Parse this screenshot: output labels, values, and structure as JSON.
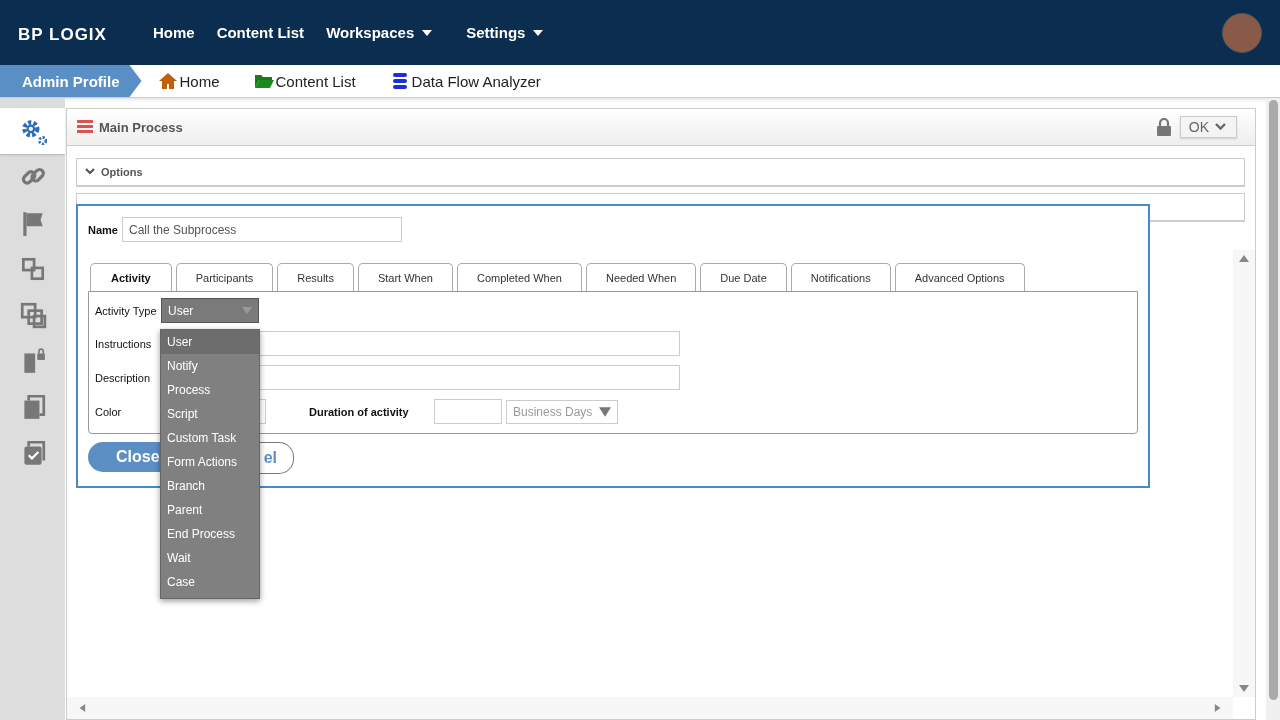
{
  "nav": {
    "logo": "BP LOGIX",
    "items": [
      {
        "label": "Home",
        "kind": "link"
      },
      {
        "label": "Content List",
        "kind": "link"
      },
      {
        "label": "Workspaces",
        "kind": "menu"
      },
      {
        "label": "Settings",
        "kind": "menu"
      }
    ]
  },
  "breadcrumb": {
    "profile": "Admin Profile",
    "links": [
      {
        "label": "Home",
        "kind": "home"
      },
      {
        "label": "Content List",
        "kind": "folder"
      },
      {
        "label": "Data Flow Analyzer",
        "kind": "stack"
      }
    ]
  },
  "sidebar": {
    "items": [
      {
        "kind": "gears",
        "selected": true
      },
      {
        "kind": "link",
        "selected": false
      },
      {
        "kind": "flag",
        "selected": false
      },
      {
        "kind": "squares",
        "selected": false
      },
      {
        "kind": "overlap",
        "selected": false
      },
      {
        "kind": "doclock",
        "selected": false
      },
      {
        "kind": "pages",
        "selected": false
      },
      {
        "kind": "check",
        "selected": false
      }
    ]
  },
  "panel": {
    "title": "Main Process",
    "ok_button": "OK",
    "sections": [
      {
        "label": "Options",
        "expanded": true
      }
    ]
  },
  "dialog": {
    "name_label": "Name",
    "name_value": "Call the Subprocess",
    "tabs": [
      {
        "label": "Activity",
        "selected": true
      },
      {
        "label": "Participants",
        "selected": false
      },
      {
        "label": "Results",
        "selected": false
      },
      {
        "label": "Start When",
        "selected": false
      },
      {
        "label": "Completed When",
        "selected": false
      },
      {
        "label": "Needed When",
        "selected": false
      },
      {
        "label": "Due Date",
        "selected": false
      },
      {
        "label": "Notifications",
        "selected": false
      },
      {
        "label": "Advanced Options",
        "selected": false
      }
    ],
    "activity_type_label": "Activity Type",
    "activity_type_value": "User",
    "instructions_label": "Instructions",
    "description_label": "Description",
    "color_label": "Color",
    "duration_label": "Duration of activity",
    "duration_unit": "Business Days",
    "buttons": [
      {
        "label": "Close",
        "kind": "primary"
      },
      {
        "label": "el",
        "kind": "secondary"
      }
    ],
    "dropdown": [
      {
        "label": "User",
        "selected": true
      },
      {
        "label": "Notify",
        "selected": false
      },
      {
        "label": "Process",
        "selected": false
      },
      {
        "label": "Script",
        "selected": false
      },
      {
        "label": "Custom Task",
        "selected": false
      },
      {
        "label": "Form Actions",
        "selected": false
      },
      {
        "label": "Branch",
        "selected": false
      },
      {
        "label": "Parent",
        "selected": false
      },
      {
        "label": "End Process",
        "selected": false
      },
      {
        "label": "Wait",
        "selected": false
      },
      {
        "label": "Case",
        "selected": false
      }
    ]
  }
}
